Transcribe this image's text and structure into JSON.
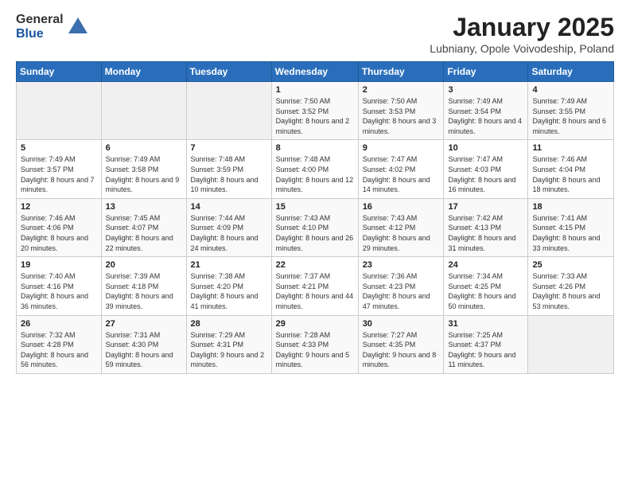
{
  "header": {
    "logo_general": "General",
    "logo_blue": "Blue",
    "month_title": "January 2025",
    "location": "Lubniany, Opole Voivodeship, Poland"
  },
  "days_of_week": [
    "Sunday",
    "Monday",
    "Tuesday",
    "Wednesday",
    "Thursday",
    "Friday",
    "Saturday"
  ],
  "weeks": [
    [
      {
        "day": "",
        "info": ""
      },
      {
        "day": "",
        "info": ""
      },
      {
        "day": "",
        "info": ""
      },
      {
        "day": "1",
        "info": "Sunrise: 7:50 AM\nSunset: 3:52 PM\nDaylight: 8 hours and 2 minutes."
      },
      {
        "day": "2",
        "info": "Sunrise: 7:50 AM\nSunset: 3:53 PM\nDaylight: 8 hours and 3 minutes."
      },
      {
        "day": "3",
        "info": "Sunrise: 7:49 AM\nSunset: 3:54 PM\nDaylight: 8 hours and 4 minutes."
      },
      {
        "day": "4",
        "info": "Sunrise: 7:49 AM\nSunset: 3:55 PM\nDaylight: 8 hours and 6 minutes."
      }
    ],
    [
      {
        "day": "5",
        "info": "Sunrise: 7:49 AM\nSunset: 3:57 PM\nDaylight: 8 hours and 7 minutes."
      },
      {
        "day": "6",
        "info": "Sunrise: 7:49 AM\nSunset: 3:58 PM\nDaylight: 8 hours and 9 minutes."
      },
      {
        "day": "7",
        "info": "Sunrise: 7:48 AM\nSunset: 3:59 PM\nDaylight: 8 hours and 10 minutes."
      },
      {
        "day": "8",
        "info": "Sunrise: 7:48 AM\nSunset: 4:00 PM\nDaylight: 8 hours and 12 minutes."
      },
      {
        "day": "9",
        "info": "Sunrise: 7:47 AM\nSunset: 4:02 PM\nDaylight: 8 hours and 14 minutes."
      },
      {
        "day": "10",
        "info": "Sunrise: 7:47 AM\nSunset: 4:03 PM\nDaylight: 8 hours and 16 minutes."
      },
      {
        "day": "11",
        "info": "Sunrise: 7:46 AM\nSunset: 4:04 PM\nDaylight: 8 hours and 18 minutes."
      }
    ],
    [
      {
        "day": "12",
        "info": "Sunrise: 7:46 AM\nSunset: 4:06 PM\nDaylight: 8 hours and 20 minutes."
      },
      {
        "day": "13",
        "info": "Sunrise: 7:45 AM\nSunset: 4:07 PM\nDaylight: 8 hours and 22 minutes."
      },
      {
        "day": "14",
        "info": "Sunrise: 7:44 AM\nSunset: 4:09 PM\nDaylight: 8 hours and 24 minutes."
      },
      {
        "day": "15",
        "info": "Sunrise: 7:43 AM\nSunset: 4:10 PM\nDaylight: 8 hours and 26 minutes."
      },
      {
        "day": "16",
        "info": "Sunrise: 7:43 AM\nSunset: 4:12 PM\nDaylight: 8 hours and 29 minutes."
      },
      {
        "day": "17",
        "info": "Sunrise: 7:42 AM\nSunset: 4:13 PM\nDaylight: 8 hours and 31 minutes."
      },
      {
        "day": "18",
        "info": "Sunrise: 7:41 AM\nSunset: 4:15 PM\nDaylight: 8 hours and 33 minutes."
      }
    ],
    [
      {
        "day": "19",
        "info": "Sunrise: 7:40 AM\nSunset: 4:16 PM\nDaylight: 8 hours and 36 minutes."
      },
      {
        "day": "20",
        "info": "Sunrise: 7:39 AM\nSunset: 4:18 PM\nDaylight: 8 hours and 39 minutes."
      },
      {
        "day": "21",
        "info": "Sunrise: 7:38 AM\nSunset: 4:20 PM\nDaylight: 8 hours and 41 minutes."
      },
      {
        "day": "22",
        "info": "Sunrise: 7:37 AM\nSunset: 4:21 PM\nDaylight: 8 hours and 44 minutes."
      },
      {
        "day": "23",
        "info": "Sunrise: 7:36 AM\nSunset: 4:23 PM\nDaylight: 8 hours and 47 minutes."
      },
      {
        "day": "24",
        "info": "Sunrise: 7:34 AM\nSunset: 4:25 PM\nDaylight: 8 hours and 50 minutes."
      },
      {
        "day": "25",
        "info": "Sunrise: 7:33 AM\nSunset: 4:26 PM\nDaylight: 8 hours and 53 minutes."
      }
    ],
    [
      {
        "day": "26",
        "info": "Sunrise: 7:32 AM\nSunset: 4:28 PM\nDaylight: 8 hours and 56 minutes."
      },
      {
        "day": "27",
        "info": "Sunrise: 7:31 AM\nSunset: 4:30 PM\nDaylight: 8 hours and 59 minutes."
      },
      {
        "day": "28",
        "info": "Sunrise: 7:29 AM\nSunset: 4:31 PM\nDaylight: 9 hours and 2 minutes."
      },
      {
        "day": "29",
        "info": "Sunrise: 7:28 AM\nSunset: 4:33 PM\nDaylight: 9 hours and 5 minutes."
      },
      {
        "day": "30",
        "info": "Sunrise: 7:27 AM\nSunset: 4:35 PM\nDaylight: 9 hours and 8 minutes."
      },
      {
        "day": "31",
        "info": "Sunrise: 7:25 AM\nSunset: 4:37 PM\nDaylight: 9 hours and 11 minutes."
      },
      {
        "day": "",
        "info": ""
      }
    ]
  ]
}
